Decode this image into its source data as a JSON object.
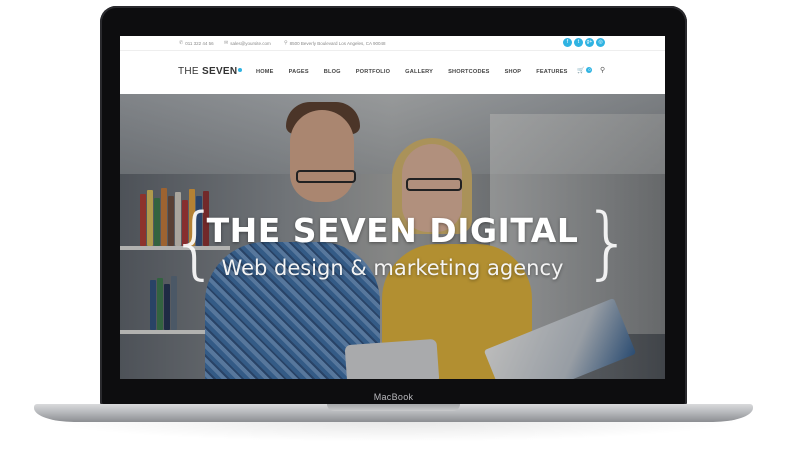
{
  "device": {
    "brand_label": "MacBook"
  },
  "topbar": {
    "phone": "011 322 44 56",
    "email": "sales@yoursite.com",
    "address": "8500 Beverly Boulevard Los Angeles, CA 90048",
    "social_icons": [
      "facebook-icon",
      "twitter-icon",
      "google-plus-icon",
      "instagram-icon"
    ],
    "social_glyphs": [
      "f",
      "t",
      "g+",
      "◎"
    ]
  },
  "header": {
    "logo_text": "THE",
    "logo_bold": "SEVEN",
    "menu": [
      "HOME",
      "PAGES",
      "BLOG",
      "PORTFOLIO",
      "GALLERY",
      "SHORTCODES",
      "SHOP",
      "FEATURES"
    ],
    "cart_glyph": "🛒",
    "cart_count": "0",
    "search_glyph": "⚲"
  },
  "hero": {
    "title": "THE SEVEN DIGITAL",
    "subtitle": "Web design & marketing agency",
    "brace_left": "{",
    "brace_right": "}"
  },
  "colors": {
    "accent": "#2fb3e2",
    "bezel": "#0d0d0f"
  }
}
